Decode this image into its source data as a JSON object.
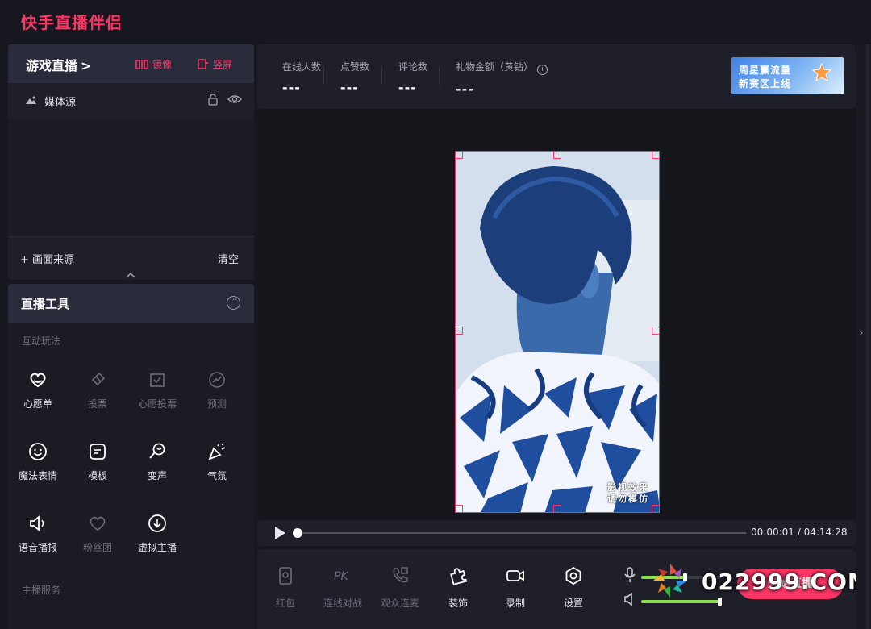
{
  "app": {
    "title": "快手直播伴侣"
  },
  "left_panel": {
    "mode": {
      "label": "游戏直播",
      "chevron": ">"
    },
    "mirror_button": "镜像",
    "portrait_button": "竖屏",
    "source": {
      "label": "媒体源",
      "icons": [
        "image-icon",
        "lock-icon",
        "eye-icon"
      ]
    },
    "add_source": "+ 画面来源",
    "clear": "清空"
  },
  "tools_panel": {
    "title": "直播工具",
    "sections": {
      "interactive": "互动玩法",
      "anchor_service": "主播服务"
    },
    "items": [
      {
        "label": "心愿单",
        "icon": "heart-icon",
        "enabled": true
      },
      {
        "label": "投票",
        "icon": "ticket-icon",
        "enabled": false
      },
      {
        "label": "心愿投票",
        "icon": "vote-box-icon",
        "enabled": false
      },
      {
        "label": "预测",
        "icon": "trend-icon",
        "enabled": false
      },
      {
        "label": "魔法表情",
        "icon": "smile-icon",
        "enabled": true
      },
      {
        "label": "模板",
        "icon": "template-icon",
        "enabled": true
      },
      {
        "label": "变声",
        "icon": "voice-change-icon",
        "enabled": true
      },
      {
        "label": "气氛",
        "icon": "party-popper-icon",
        "enabled": true
      },
      {
        "label": "语音播报",
        "icon": "speaker-icon",
        "enabled": true
      },
      {
        "label": "粉丝团",
        "icon": "fan-heart-icon",
        "enabled": false
      },
      {
        "label": "虚拟主播",
        "icon": "download-circle-icon",
        "enabled": true
      }
    ]
  },
  "stats": {
    "online": {
      "label": "在线人数",
      "value": "---"
    },
    "likes": {
      "label": "点赞数",
      "value": "---"
    },
    "comments": {
      "label": "评论数",
      "value": "---"
    },
    "gifts": {
      "label": "礼物金额（黄钻）",
      "value": "---"
    }
  },
  "banner": {
    "line1": "周星赢流量",
    "line2": "新赛区上线"
  },
  "preview": {
    "watermark_line1": "影视效果",
    "watermark_line2": "请勿模仿"
  },
  "playback": {
    "time": "00:00:01 / 04:14:28",
    "progress": 0.0
  },
  "bottom_bar": {
    "items": [
      {
        "label": "红包",
        "enabled": false
      },
      {
        "label": "连线对战",
        "enabled": false
      },
      {
        "label": "观众连麦",
        "enabled": false
      },
      {
        "label": "装饰",
        "enabled": true
      },
      {
        "label": "录制",
        "enabled": true
      },
      {
        "label": "设置",
        "enabled": true
      }
    ],
    "mic_level": 0.55,
    "speaker_level": 0.98,
    "start_button": "开始直播",
    "overlay_watermark": "022999.COM"
  },
  "colors": {
    "accent": "#fe3666",
    "panel": "#1f1f2a",
    "background": "#17171f",
    "volume": "#8ae04a"
  }
}
